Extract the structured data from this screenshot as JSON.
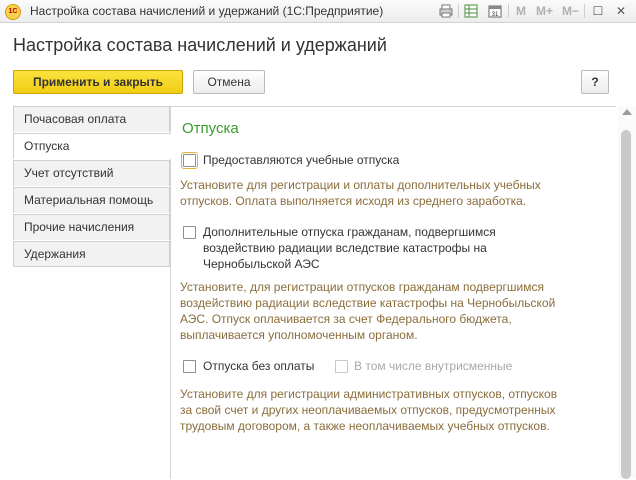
{
  "window": {
    "title": "Настройка состава начислений и удержаний  (1С:Предприятие)",
    "logo_text": "1С",
    "toolbar_icons": [
      "print-icon",
      "table-icon",
      "calendar-icon"
    ],
    "calendar_day": "31",
    "memory_buttons": [
      "M",
      "M+",
      "M−"
    ],
    "maximize_glyph": "☐",
    "close_glyph": "✕"
  },
  "page": {
    "title": "Настройка состава начислений и удержаний"
  },
  "actions": {
    "apply_close": "Применить и закрыть",
    "cancel": "Отмена",
    "help": "?"
  },
  "nav": {
    "items": [
      {
        "label": "Почасовая оплата"
      },
      {
        "label": "Отпуска"
      },
      {
        "label": "Учет отсутствий"
      },
      {
        "label": "Материальная помощь"
      },
      {
        "label": "Прочие начисления"
      },
      {
        "label": "Удержания"
      }
    ],
    "active_index": 1
  },
  "content": {
    "section_title": "Отпуска",
    "study_leave": {
      "label": "Предоставляются учебные отпуска",
      "checked": false,
      "hint_lines": [
        "Установите для регистрации и оплаты дополнительных учебных",
        "отпусков. Оплата выполняется исходя из среднего заработка."
      ]
    },
    "chernobyl_leave": {
      "label_lines": [
        "Дополнительные отпуска гражданам, подвергшимся",
        "воздействию радиации вследствие катастрофы на",
        "Чернобыльской АЭС"
      ],
      "checked": false,
      "hint_lines": [
        "Установите, для регистрации отпусков гражданам подвергшимся",
        "воздействию радиации вследствие катастрофы на Чернобыльской",
        "АЭС. Отпуск оплачивается за счет Федерального бюджета,",
        "выплачивается уполномоченным органом."
      ]
    },
    "unpaid_leave": {
      "label": "Отпуска без оплаты",
      "checked": false,
      "intra_shift_label": "В том числе внутрисменные",
      "intra_shift_checked": false,
      "hint_lines": [
        "Установите для регистрации административных отпусков, отпусков",
        "за свой счет и других неоплачиваемых отпусков, предусмотренных",
        "трудовым договором, а также неоплачиваемых учебных отпусков."
      ]
    }
  },
  "colors": {
    "primary_button": "#f2cc13",
    "section_title": "#3b9a2f",
    "hint_text": "#8a6d3b"
  }
}
